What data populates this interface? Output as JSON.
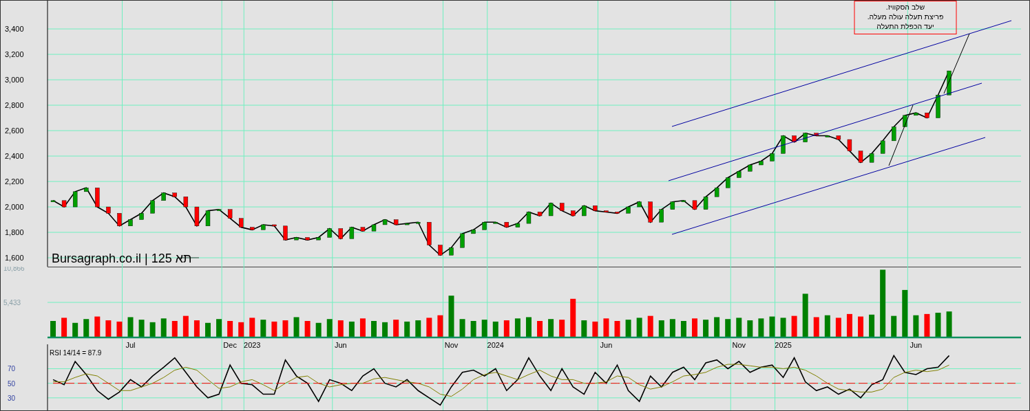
{
  "price_chart": {
    "chart_data": {
      "type": "line",
      "title": "Bursagraph.co.il | תא 125",
      "grid": true,
      "series": [
        {
          "color": "#000000",
          "values": [
            2050,
            2000,
            2120,
            2150,
            2000,
            1950,
            1850,
            1900,
            1950,
            2050,
            2110,
            2080,
            2000,
            1850,
            1970,
            1980,
            1910,
            1840,
            1820,
            1860,
            1850,
            1740,
            1760,
            1740,
            1760,
            1830,
            1750,
            1840,
            1810,
            1860,
            1900,
            1860,
            1870,
            1880,
            1700,
            1620,
            1680,
            1790,
            1820,
            1880,
            1880,
            1840,
            1870,
            1960,
            1930,
            2030,
            1970,
            1930,
            2010,
            1970,
            1960,
            1950,
            2000,
            2040,
            1880,
            1980,
            2040,
            2050,
            1980,
            2080,
            2150,
            2230,
            2280,
            2330,
            2360,
            2420,
            2560,
            2510,
            2580,
            2560,
            2560,
            2530,
            2440,
            2350,
            2420,
            2520,
            2630,
            2720,
            2740,
            2700,
            2880,
            3070,
            null,
            null,
            null,
            null,
            null,
            null
          ]
        }
      ],
      "ylim": [
        1530,
        3622
      ],
      "yticks": [
        {
          "value": 1600,
          "label": "1,600"
        },
        {
          "value": 1800,
          "label": "1,800"
        },
        {
          "value": 2000,
          "label": "2,000"
        },
        {
          "value": 2200,
          "label": "2,200"
        },
        {
          "value": 2400,
          "label": "2,400"
        },
        {
          "value": 2600,
          "label": "2,600"
        },
        {
          "value": 2800,
          "label": "2,800"
        },
        {
          "value": 3000,
          "label": "3,000"
        },
        {
          "value": 3200,
          "label": "3,200"
        },
        {
          "value": 3400,
          "label": "3,400"
        }
      ],
      "annotations": [
        "שלב הסקוויז.",
        "פריצת תעלה עולה מעלה.",
        "יעד הכפלת התעלה"
      ]
    }
  },
  "volume_chart": {
    "chart_data": {
      "type": "bar",
      "grid": true,
      "ylim": [
        0,
        11083
      ],
      "yticks": [
        {
          "value": 5433,
          "label": "5,433"
        },
        {
          "value": 10866,
          "label": "10,866"
        }
      ],
      "series": [
        {
          "values": [
            2500,
            3000,
            2200,
            2800,
            3200,
            2600,
            2400,
            3100,
            2700,
            2300,
            2900,
            2500,
            3300,
            2600,
            2200,
            2800,
            2500,
            2300,
            3000,
            2700,
            2400,
            2600,
            3100,
            2500,
            2200,
            2800,
            2600,
            2400,
            2900,
            2500,
            2300,
            2700,
            2400,
            2600,
            3000,
            3400,
            6500,
            2800,
            2500,
            2700,
            2400,
            2600,
            2900,
            3100,
            2500,
            2800,
            2700,
            6000,
            2600,
            2400,
            2900,
            2500,
            2700,
            3000,
            3300,
            2600,
            2800,
            2500,
            2900,
            2700,
            3100,
            2800,
            3000,
            2600,
            2900,
            3200,
            3000,
            3300,
            6800,
            3100,
            3400,
            3000,
            3600,
            3200,
            3500,
            10600,
            3300,
            7400,
            3400,
            3600,
            3800,
            4000,
            null,
            null,
            null,
            null,
            null,
            null
          ]
        }
      ]
    }
  },
  "rsi_chart": {
    "label": "RSI 14/14 = 87.9",
    "chart_data": {
      "type": "line",
      "grid": true,
      "ylim": [
        11,
        111
      ],
      "categories": [
        null,
        null,
        null,
        null,
        null,
        null,
        null,
        "Jul",
        null,
        null,
        null,
        null,
        null,
        null,
        null,
        null,
        "Dec",
        null,
        "2023",
        null,
        null,
        null,
        null,
        null,
        null,
        null,
        "Jun",
        null,
        null,
        null,
        null,
        null,
        null,
        null,
        null,
        null,
        "Nov",
        null,
        null,
        null,
        "2024",
        null,
        null,
        null,
        null,
        null,
        null,
        null,
        null,
        null,
        "Jun",
        null,
        null,
        null,
        null,
        null,
        null,
        null,
        null,
        null,
        null,
        null,
        "Nov",
        null,
        null,
        null,
        "2025",
        null,
        null,
        null,
        null,
        null,
        null,
        null,
        null,
        null,
        null,
        null,
        "Jun",
        null,
        null,
        null,
        null,
        null,
        null,
        null,
        null,
        null
      ],
      "yticks": [
        {
          "value": 30,
          "label": "30"
        },
        {
          "value": 50,
          "label": "50"
        },
        {
          "value": 70,
          "label": "70"
        }
      ],
      "series": [
        {
          "color": "#000000",
          "values": [
            55,
            48,
            80,
            62,
            40,
            28,
            38,
            55,
            45,
            60,
            72,
            85,
            65,
            45,
            30,
            35,
            75,
            50,
            48,
            35,
            35,
            82,
            60,
            50,
            25,
            55,
            50,
            40,
            60,
            70,
            50,
            45,
            55,
            40,
            30,
            20,
            45,
            65,
            68,
            60,
            70,
            40,
            55,
            85,
            60,
            40,
            70,
            45,
            35,
            65,
            50,
            75,
            40,
            25,
            60,
            45,
            65,
            72,
            55,
            78,
            82,
            70,
            80,
            65,
            72,
            75,
            58,
            85,
            52,
            40,
            45,
            35,
            42,
            30,
            48,
            55,
            88,
            65,
            62,
            70,
            72,
            88,
            null,
            null,
            null,
            null,
            null,
            null
          ]
        },
        {
          "color": "#808000",
          "values": [
            52,
            52,
            58,
            63,
            60,
            50,
            40,
            40,
            45,
            50,
            58,
            68,
            72,
            68,
            55,
            43,
            45,
            52,
            55,
            48,
            40,
            50,
            58,
            60,
            50,
            45,
            48,
            50,
            50,
            56,
            58,
            55,
            52,
            50,
            45,
            35,
            32,
            42,
            55,
            62,
            65,
            60,
            55,
            62,
            68,
            60,
            55,
            55,
            50,
            50,
            52,
            60,
            58,
            48,
            42,
            45,
            52,
            60,
            62,
            65,
            72,
            76,
            76,
            74,
            72,
            72,
            70,
            72,
            68,
            60,
            50,
            42,
            40,
            38,
            38,
            42,
            58,
            65,
            68,
            66,
            68,
            75,
            null,
            null,
            null,
            null,
            null,
            null
          ]
        },
        {
          "color": "#ff0000",
          "line_style": "dashed",
          "values": [
            50,
            50,
            50,
            50,
            50,
            50,
            50,
            50,
            50,
            50,
            50,
            50,
            50,
            50,
            50,
            50,
            50,
            50,
            50,
            50,
            50,
            50,
            50,
            50,
            50,
            50,
            50,
            50,
            50,
            50,
            50,
            50,
            50,
            50,
            50,
            50,
            50,
            50,
            50,
            50,
            50,
            50,
            50,
            50,
            50,
            50,
            50,
            50,
            50,
            50,
            50,
            50,
            50,
            50,
            50,
            50,
            50,
            50,
            50,
            50,
            50,
            50,
            50,
            50,
            50,
            50,
            50,
            50,
            50,
            50,
            50,
            50,
            50,
            50,
            50,
            50,
            50,
            50,
            50,
            50,
            50,
            50,
            50,
            50,
            50,
            50,
            50,
            50
          ]
        }
      ]
    }
  }
}
